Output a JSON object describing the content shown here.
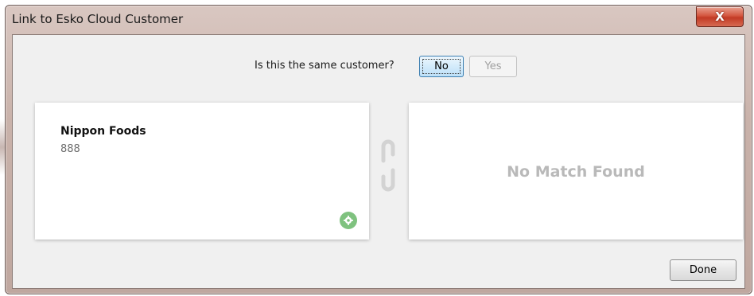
{
  "window": {
    "title": "Link to Esko Cloud Customer",
    "close_label": "X"
  },
  "prompt": {
    "question": "Is this the same customer?",
    "no_label": "No",
    "yes_label": "Yes"
  },
  "left_card": {
    "name": "Nippon Foods",
    "id": "888",
    "badge_icon": "gear-icon",
    "badge_color": "#7fc27f"
  },
  "link_icon": "chain-link-icon",
  "right_card": {
    "message": "No Match Found"
  },
  "footer": {
    "done_label": "Done"
  }
}
